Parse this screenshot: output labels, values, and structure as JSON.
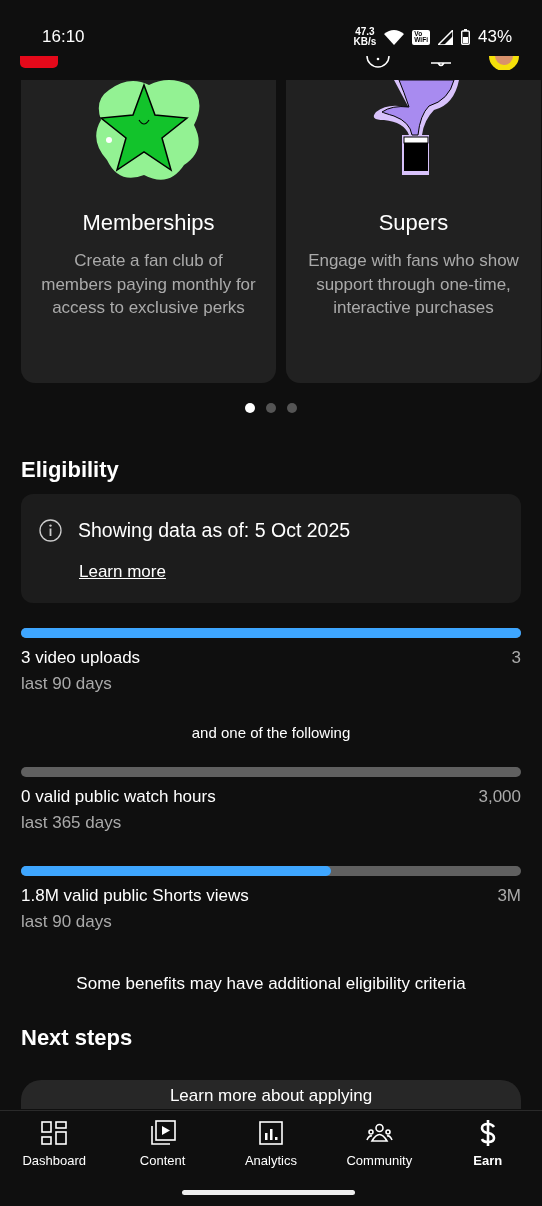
{
  "status_bar": {
    "time": "16:10",
    "speed": "47.3",
    "speed_unit": "KB/s",
    "wifi_badge": [
      "Vo",
      "WiFi"
    ],
    "battery": "43%"
  },
  "features": [
    {
      "kind": "star",
      "title": "Memberships",
      "text": "Create a fan club of members paying monthly for access to exclusive perks"
    },
    {
      "kind": "plant",
      "title": "Supers",
      "text": "Engage with fans who show support through one-time, interactive purchases"
    }
  ],
  "carousel_dots": [
    {
      "selected": true
    },
    {
      "selected": false
    },
    {
      "selected": false
    }
  ],
  "eligibility": {
    "title": "Eligibility",
    "notice": "Showing data as of: 5 Oct 2025",
    "link": "Learn more",
    "requirements": [
      {
        "level": 1,
        "label": "3 video uploads",
        "period": "last 90 days",
        "target": "3"
      }
    ],
    "separator": "and one of the following",
    "alternatives": [
      {
        "level": 0,
        "label": "0 valid public watch hours",
        "period": "last 365 days",
        "target": "3,000"
      },
      {
        "level": 0.62,
        "label": "1.8M valid public Shorts views",
        "period": "last 90 days",
        "target": "3M"
      }
    ],
    "footnote": "Some benefits may have additional eligibility criteria"
  },
  "next_steps": {
    "title": "Next steps",
    "button": "Learn more about applying"
  },
  "nav": [
    {
      "kind": "dashboard",
      "label": "Dashboard",
      "selected": false
    },
    {
      "kind": "content",
      "label": "Content",
      "selected": false
    },
    {
      "kind": "analytics",
      "label": "Analytics",
      "selected": false
    },
    {
      "kind": "community",
      "label": "Community",
      "selected": false
    },
    {
      "kind": "earn",
      "label": "Earn",
      "selected": true
    }
  ]
}
